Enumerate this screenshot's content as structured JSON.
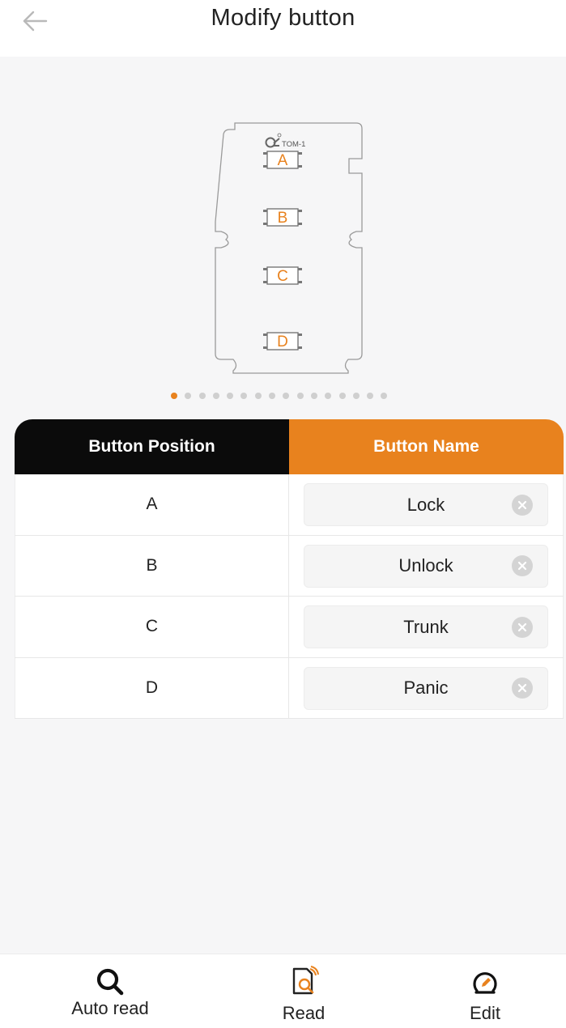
{
  "header": {
    "title": "Modify button",
    "back_icon": "arrow-left-icon"
  },
  "illustration": {
    "model_label": "TOM-1",
    "keys": [
      "A",
      "B",
      "C",
      "D"
    ],
    "accent_color": "#e8821e"
  },
  "carousel": {
    "total_pages": 16,
    "active_index": 0
  },
  "table": {
    "col_position": "Button Position",
    "col_name": "Button Name",
    "rows": [
      {
        "position": "A",
        "name": "Lock"
      },
      {
        "position": "B",
        "name": "Unlock"
      },
      {
        "position": "C",
        "name": "Trunk"
      },
      {
        "position": "D",
        "name": "Panic"
      }
    ],
    "clear_icon": "clear-circle-icon"
  },
  "bottom_nav": {
    "items": [
      {
        "label": "Auto read",
        "icon": "search-icon"
      },
      {
        "label": "Read",
        "icon": "document-read-icon"
      },
      {
        "label": "Edit",
        "icon": "edit-circle-icon"
      }
    ]
  },
  "colors": {
    "accent": "#e8821e",
    "header_dark": "#0b0b0b",
    "background": "#f6f6f7"
  }
}
